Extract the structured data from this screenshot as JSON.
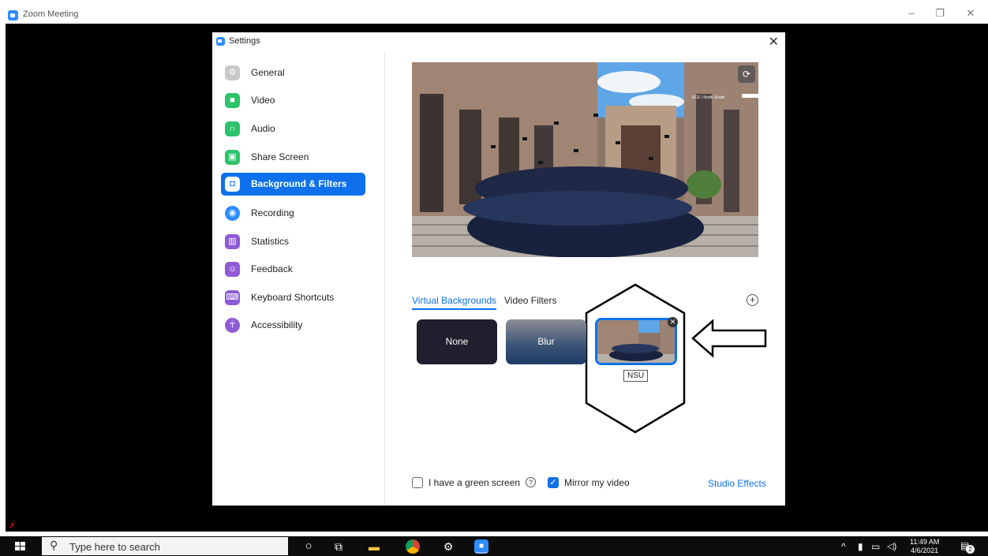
{
  "window": {
    "title": "Zoom Meeting",
    "minimize": "–",
    "restore": "❐",
    "close": "✕"
  },
  "dialog": {
    "title": "Settings",
    "close": "✕"
  },
  "sidebar": {
    "items": [
      {
        "label": "General",
        "icon": "gear-icon",
        "color": "#c8c8c8"
      },
      {
        "label": "Video",
        "icon": "video-camera-icon",
        "color": "#2dc26b"
      },
      {
        "label": "Audio",
        "icon": "headphones-icon",
        "color": "#2dc26b"
      },
      {
        "label": "Share Screen",
        "icon": "share-screen-icon",
        "color": "#2dc26b"
      },
      {
        "label": "Background & Filters",
        "icon": "person-portrait-icon",
        "color": "#0e71eb"
      },
      {
        "label": "Recording",
        "icon": "record-icon",
        "color": "#2d8cff"
      },
      {
        "label": "Statistics",
        "icon": "bar-chart-icon",
        "color": "#8e5bd6"
      },
      {
        "label": "Feedback",
        "icon": "smiley-icon",
        "color": "#8e5bd6"
      },
      {
        "label": "Keyboard Shortcuts",
        "icon": "keyboard-icon",
        "color": "#8e5bd6"
      },
      {
        "label": "Accessibility",
        "icon": "accessibility-icon",
        "color": "#8e5bd6"
      }
    ],
    "active_index": 4
  },
  "preview": {
    "watermark": "ECE | North South"
  },
  "tabs": {
    "virtual": "Virtual Backgrounds",
    "filters": "Video Filters"
  },
  "backgrounds": {
    "none": "None",
    "blur": "Blur",
    "selected_tooltip": "NSU"
  },
  "footer": {
    "green_screen": "I have a green screen",
    "mirror": "Mirror my video",
    "studio_effects": "Studio Effects",
    "green_screen_checked": false,
    "mirror_checked": true
  },
  "taskbar": {
    "search_placeholder": "Type here to search",
    "time": "11:49 AM",
    "date": "4/6/2021",
    "notifications": "2"
  }
}
